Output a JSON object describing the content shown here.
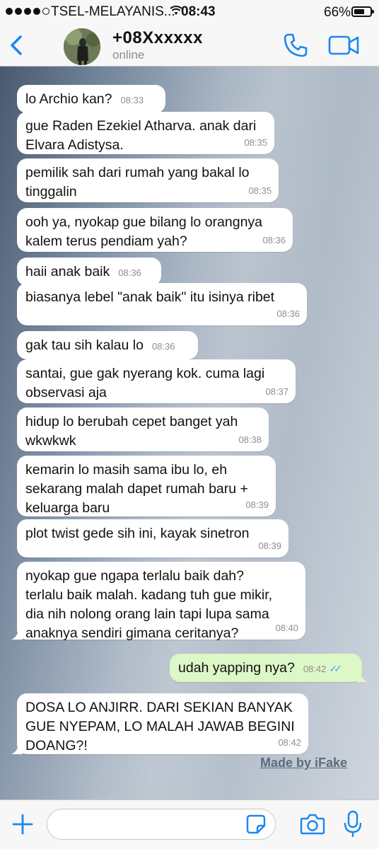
{
  "status_bar": {
    "carrier": "TSEL-MELAYANIS...",
    "time": "08:43",
    "battery": "66%",
    "battery_level": 0.66
  },
  "header": {
    "back_icon": "chevron-left-icon",
    "contact_name": "+08Xxxxxx",
    "contact_status": "online",
    "call_icon": "phone-icon",
    "video_icon": "video-camera-icon"
  },
  "messages": [
    {
      "text": "lo Archio kan?",
      "time": "08:33",
      "dir": "in"
    },
    {
      "text": "gue Raden Ezekiel Atharva. anak dari\nElvara Adistysa.",
      "time": "08:35",
      "dir": "in"
    },
    {
      "text": "pemilik sah dari rumah yang bakal lo\ntinggalin",
      "time": "08:35",
      "dir": "in"
    },
    {
      "text": "ooh ya, nyokap gue bilang lo orangnya\nkalem terus pendiam yah?",
      "time": "08:36",
      "dir": "in"
    },
    {
      "text": "haii anak baik",
      "time": "08:36",
      "dir": "in"
    },
    {
      "text": "biasanya lebel \"anak baik\" itu isinya ribet",
      "time": "08:36",
      "dir": "in"
    },
    {
      "text": "gak tau sih kalau lo",
      "time": "08:36",
      "dir": "in"
    },
    {
      "text": "santai, gue gak nyerang kok. cuma lagi\nobservasi aja",
      "time": "08:37",
      "dir": "in"
    },
    {
      "text": "hidup lo berubah cepet banget yah\nwkwkwk",
      "time": "08:38",
      "dir": "in"
    },
    {
      "text": "kemarin lo masih sama ibu lo, eh\nsekarang malah dapet rumah baru +\nkeluarga baru",
      "time": "08:39",
      "dir": "in"
    },
    {
      "text": "plot twist gede sih ini, kayak sinetron",
      "time": "08:39",
      "dir": "in"
    },
    {
      "text": "nyokap gue ngapa terlalu baik dah?\nterlalu baik malah. kadang tuh gue mikir,\ndia nih nolong orang lain tapi lupa sama\nanaknya sendiri gimana ceritanya?",
      "time": "08:40",
      "dir": "in"
    },
    {
      "text": "udah yapping nya?",
      "time": "08:42",
      "dir": "out",
      "ticks": "✓✓"
    },
    {
      "text": "DOSA LO ANJIRR. DARI SEKIAN BANYAK\nGUE NYEPAM, LO MALAH JAWAB BEGINI\nDOANG?!",
      "time": "08:42",
      "dir": "in"
    }
  ],
  "watermark": "Made by iFake",
  "input_bar": {
    "plus_icon": "plus-icon",
    "placeholder": "",
    "sticker_icon": "sticker-icon",
    "camera_icon": "camera-icon",
    "mic_icon": "microphone-icon"
  },
  "colors": {
    "accent": "#1b87f0",
    "incoming_bubble": "#ffffff",
    "outgoing_bubble": "#dcf8c6",
    "read_ticks": "#4fa8e6"
  }
}
